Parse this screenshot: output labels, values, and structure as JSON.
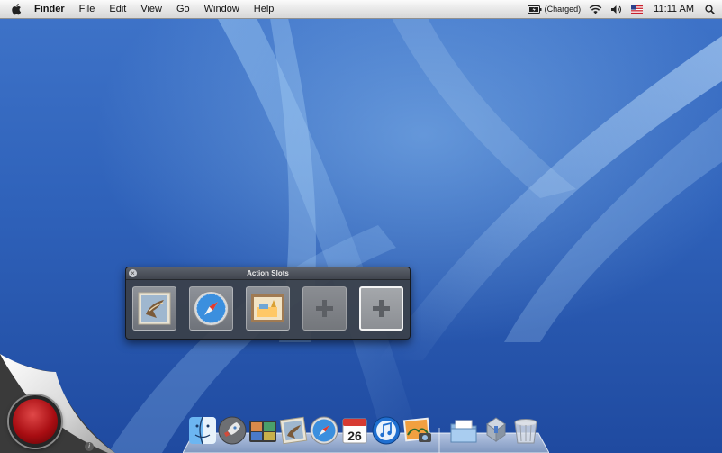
{
  "menubar": {
    "app_name": "Finder",
    "menus": [
      "File",
      "Edit",
      "View",
      "Go",
      "Window",
      "Help"
    ],
    "battery_status": "(Charged)",
    "clock": "11:11 AM",
    "icons": [
      "apple-icon",
      "battery-icon",
      "wifi-icon",
      "volume-icon",
      "us-flag-icon",
      "spotlight-icon"
    ]
  },
  "action_slots": {
    "title": "Action Slots",
    "slots": [
      {
        "type": "app",
        "icon": "mail-icon"
      },
      {
        "type": "app",
        "icon": "safari-icon"
      },
      {
        "type": "app",
        "icon": "preview-icon"
      },
      {
        "type": "empty",
        "icon": "plus-icon"
      },
      {
        "type": "empty",
        "icon": "plus-icon",
        "highlighted": true
      }
    ]
  },
  "dock": {
    "items": [
      "finder-icon",
      "launchpad-icon",
      "photo-booth-icon",
      "mail-icon",
      "safari-icon",
      "calendar-icon",
      "itunes-icon",
      "iphoto-icon",
      "documents-folder-icon",
      "utility-icon",
      "trash-icon"
    ],
    "calendar_day": "26"
  },
  "colors": {
    "wallpaper": "#2f62ba",
    "record": "#c31f24",
    "panel": "#3a3f48"
  }
}
